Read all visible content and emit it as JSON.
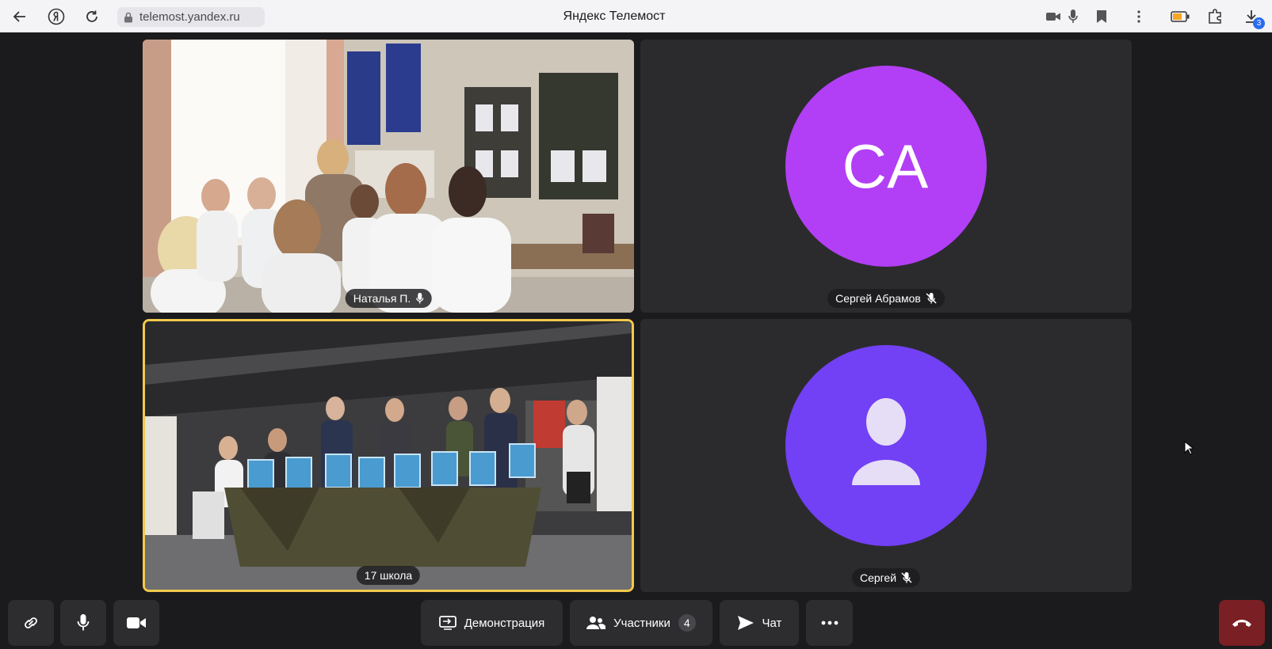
{
  "browser": {
    "url": "telemost.yandex.ru",
    "page_title": "Яндекс Телемост",
    "downloads_badge": "3"
  },
  "tiles": [
    {
      "name": "Наталья П.",
      "mic": "on",
      "type": "video"
    },
    {
      "name": "Сергей Абрамов",
      "mic": "off",
      "type": "avatar",
      "initials": "СА",
      "avatar_color": "#b23ff5"
    },
    {
      "name": "17 школа",
      "type": "video",
      "active_speaker": true,
      "highlight_color": "#f2c94c"
    },
    {
      "name": "Сергей",
      "mic": "off",
      "type": "avatar",
      "avatar_color": "#7240f5",
      "avatar_icon": "person-icon"
    }
  ],
  "toolbar": {
    "link_icon": "link-icon",
    "mic_icon": "microphone-icon",
    "camera_icon": "camera-icon",
    "screen_share_label": "Демонстрация",
    "participants_label": "Участники",
    "participants_count": "4",
    "chat_label": "Чат",
    "more_icon": "more-icon",
    "hangup_icon": "hangup-icon",
    "hangup_color": "#7a1f23"
  }
}
